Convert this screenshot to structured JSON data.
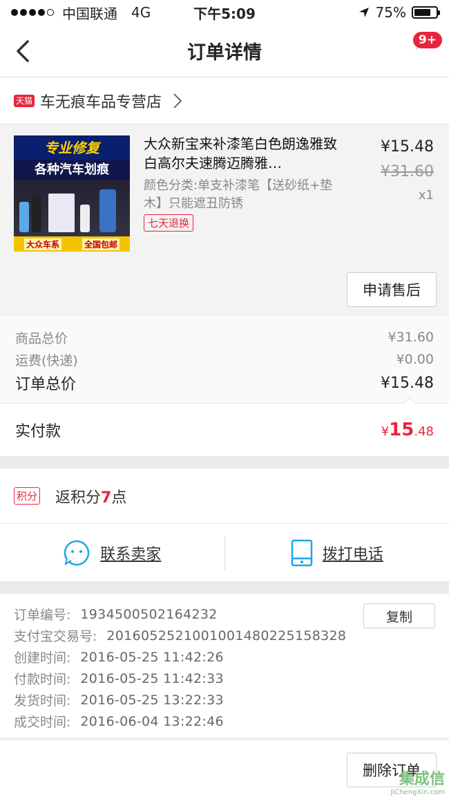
{
  "status_bar": {
    "carrier": "中国联通",
    "network": "4G",
    "time": "下午5:09",
    "battery": "75%",
    "battery_level": 0.75
  },
  "nav": {
    "title": "订单详情",
    "badge": "9+"
  },
  "shop": {
    "icon_text": "天猫",
    "name": "车无痕车品专营店"
  },
  "product": {
    "image_text": {
      "top": "专业修复",
      "mid": "各种汽车划痕",
      "bottom_left": "大众车系",
      "bottom_right": "全国包邮"
    },
    "title": "大众新宝来补漆笔白色朗逸雅致白高尔夫速腾迈腾雅…",
    "attributes": "颜色分类:单支补漆笔【送砂纸+垫木】只能遮丑防锈",
    "tag": "七天退换",
    "price": "¥15.48",
    "original_price": "¥31.60",
    "quantity": "x1",
    "after_sale_button": "申请售后"
  },
  "totals": {
    "goods_label": "商品总价",
    "goods_value": "¥31.60",
    "shipping_label": "运费(快递)",
    "shipping_value": "¥0.00",
    "order_label": "订单总价",
    "order_value": "¥15.48"
  },
  "payment": {
    "label": "实付款",
    "currency": "¥",
    "integer": "15",
    "decimal": ".48"
  },
  "points": {
    "icon_text": "积分",
    "prefix": "返积分",
    "number": "7",
    "suffix": "点"
  },
  "contact": {
    "seller_label": "联系卖家",
    "phone_label": "拨打电话"
  },
  "order_info": {
    "copy_button": "复制",
    "rows": [
      {
        "label": "订单编号:",
        "value": "1934500502164232"
      },
      {
        "label": "支付宝交易号:",
        "value": "2016052521001001480225158328"
      },
      {
        "label": "创建时间:",
        "value": "2016-05-25 11:42:26"
      },
      {
        "label": "付款时间:",
        "value": "2016-05-25 11:42:33"
      },
      {
        "label": "发货时间:",
        "value": "2016-05-25 13:22:33"
      },
      {
        "label": "成交时间:",
        "value": "2016-06-04 13:22:46"
      }
    ]
  },
  "bottom": {
    "delete_button": "删除订单"
  },
  "watermark": {
    "top": "集成信",
    "bottom": "JiChengXin.com"
  },
  "colors": {
    "accent": "#e8253f",
    "tmall": "#e8253f",
    "contact_icon": "#1aa6e8"
  }
}
